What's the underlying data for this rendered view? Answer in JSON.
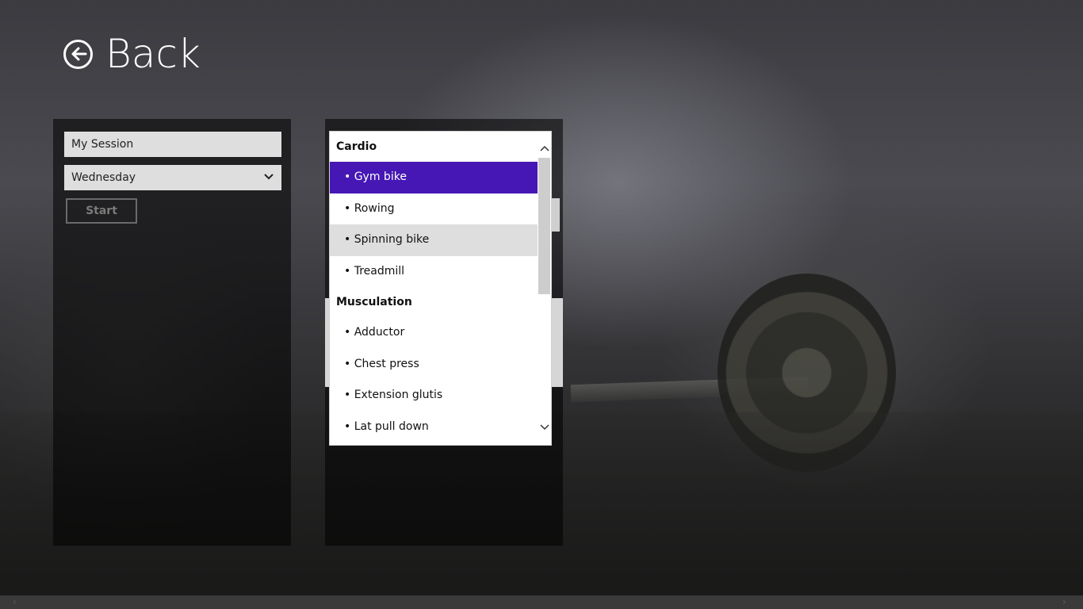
{
  "header": {
    "back_label": "Back"
  },
  "session": {
    "name_value": "My Session",
    "day_value": "Wednesday",
    "start_label": "Start"
  },
  "exercises": {
    "groups": [
      {
        "title": "Cardio",
        "items": [
          "• Gym bike",
          "• Rowing",
          "• Spinning bike",
          "• Treadmill"
        ]
      },
      {
        "title": "Musculation",
        "items": [
          "• Adductor",
          "• Chest press",
          "• Extension glutis",
          "• Lat pull down"
        ]
      }
    ],
    "selected_item": "• Gym bike",
    "hovered_item": "• Spinning bike"
  },
  "colors": {
    "accent": "#4617b4",
    "input_bg": "#dedede",
    "panel_bg": "#000000"
  },
  "icons": {
    "back": "arrow-left-circle-icon",
    "dropdown": "chevron-down-icon",
    "scroll_up": "chevron-up-icon",
    "scroll_down": "chevron-down-icon"
  }
}
